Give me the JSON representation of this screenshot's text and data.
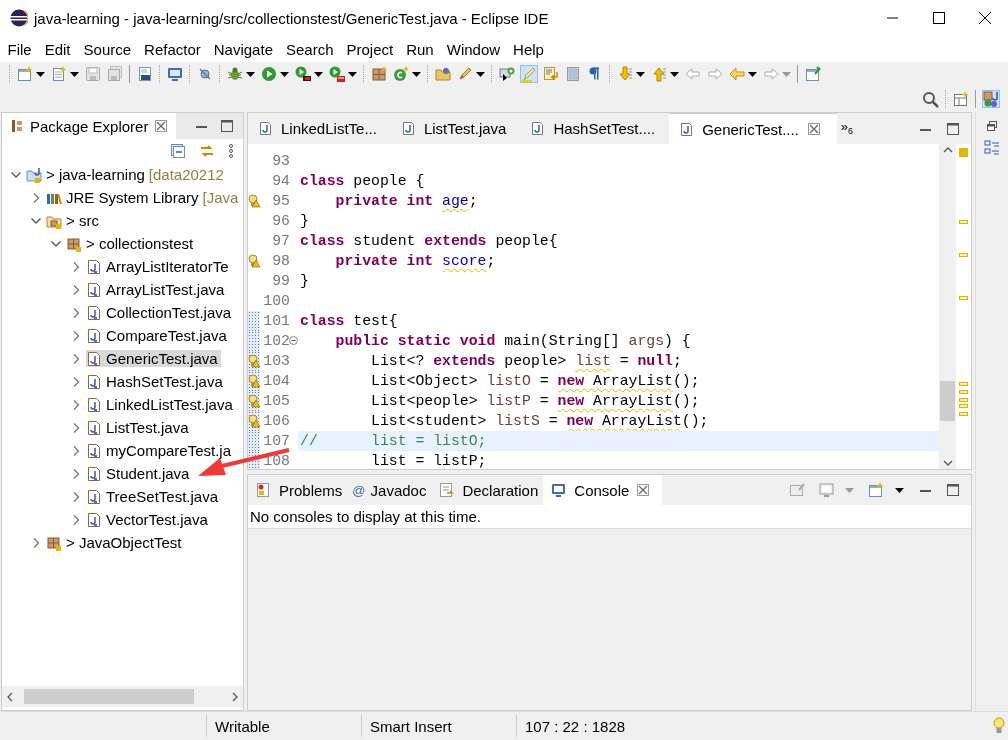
{
  "window": {
    "title": "java-learning - java-learning/src/collectionstest/GenericTest.java - Eclipse IDE"
  },
  "menu": [
    "File",
    "Edit",
    "Source",
    "Refactor",
    "Navigate",
    "Search",
    "Project",
    "Run",
    "Window",
    "Help"
  ],
  "package_explorer": {
    "title": "Package Explorer",
    "tree": [
      {
        "label": "> java-learning",
        "decoration": "[data20212",
        "kind": "project",
        "expanded": true,
        "selected": false,
        "children": [
          {
            "label": "JRE System Library",
            "decoration": "[Java",
            "kind": "library",
            "expanded": false,
            "selected": false
          },
          {
            "label": "> src",
            "kind": "source",
            "expanded": true,
            "selected": false,
            "children": [
              {
                "label": "> collectionstest",
                "kind": "package",
                "expanded": true,
                "selected": false,
                "children": [
                  {
                    "label": "ArrayListIteratorTe",
                    "kind": "file",
                    "expanded": false,
                    "selected": false
                  },
                  {
                    "label": "ArrayListTest.java",
                    "kind": "file",
                    "expanded": false,
                    "selected": false
                  },
                  {
                    "label": "CollectionTest.java",
                    "kind": "file",
                    "expanded": false,
                    "selected": false
                  },
                  {
                    "label": "CompareTest.java",
                    "kind": "file",
                    "expanded": false,
                    "selected": false
                  },
                  {
                    "label": "GenericTest.java",
                    "kind": "file",
                    "expanded": false,
                    "selected": true
                  },
                  {
                    "label": "HashSetTest.java",
                    "kind": "file",
                    "expanded": false,
                    "selected": false
                  },
                  {
                    "label": "LinkedListTest.java",
                    "kind": "file",
                    "expanded": false,
                    "selected": false
                  },
                  {
                    "label": "ListTest.java",
                    "kind": "file",
                    "expanded": false,
                    "selected": false
                  },
                  {
                    "label": "myCompareTest.ja",
                    "kind": "file",
                    "expanded": false,
                    "selected": false
                  },
                  {
                    "label": "Student.java",
                    "kind": "file",
                    "expanded": false,
                    "selected": false
                  },
                  {
                    "label": "TreeSetTest.java",
                    "kind": "file",
                    "expanded": false,
                    "selected": false
                  },
                  {
                    "label": "VectorTest.java",
                    "kind": "file",
                    "expanded": false,
                    "selected": false
                  }
                ]
              }
            ]
          },
          {
            "label": "> JavaObjectTest",
            "kind": "package",
            "expanded": false,
            "selected": false
          }
        ]
      }
    ]
  },
  "editor": {
    "tabs": [
      {
        "label": "LinkedListTe...",
        "selected": false
      },
      {
        "label": "ListTest.java",
        "selected": false
      },
      {
        "label": "HashSetTest....",
        "selected": false
      },
      {
        "label": "GenericTest....",
        "selected": true
      }
    ],
    "overflow": {
      "symbol": "»",
      "count": "6"
    },
    "lines": [
      {
        "number": "93"
      },
      {
        "number": "94",
        "tokens": [
          {
            "text": "class",
            "kind": "keyword"
          },
          {
            "text": " people {",
            "kind": "plain"
          }
        ]
      },
      {
        "number": "95",
        "warning": true,
        "tokens": [
          {
            "text": "    private int ",
            "kind": "keyword"
          },
          {
            "text": "age",
            "kind": "field",
            "warn": true
          },
          {
            "text": ";",
            "kind": "plain"
          }
        ]
      },
      {
        "number": "96",
        "tokens": [
          {
            "text": "}",
            "kind": "plain"
          }
        ]
      },
      {
        "number": "97",
        "tokens": [
          {
            "text": "class",
            "kind": "keyword"
          },
          {
            "text": " student ",
            "kind": "plain"
          },
          {
            "text": "extends",
            "kind": "keyword"
          },
          {
            "text": " people{",
            "kind": "plain"
          }
        ]
      },
      {
        "number": "98",
        "warning": true,
        "tokens": [
          {
            "text": "    private int ",
            "kind": "keyword"
          },
          {
            "text": "score",
            "kind": "field",
            "warn": true
          },
          {
            "text": ";",
            "kind": "plain"
          }
        ]
      },
      {
        "number": "99",
        "tokens": [
          {
            "text": "}",
            "kind": "plain"
          }
        ]
      },
      {
        "number": "100"
      },
      {
        "number": "101",
        "changed": true,
        "tokens": [
          {
            "text": "class",
            "kind": "keyword"
          },
          {
            "text": " test{",
            "kind": "plain"
          }
        ]
      },
      {
        "number": "102",
        "changed": true,
        "foldable": true,
        "tokens": [
          {
            "text": "    public static void",
            "kind": "keyword"
          },
          {
            "text": " main(String[] ",
            "kind": "plain"
          },
          {
            "text": "args",
            "kind": "local"
          },
          {
            "text": ") {",
            "kind": "plain"
          }
        ]
      },
      {
        "number": "103",
        "changed": true,
        "warning": true,
        "tokens": [
          {
            "text": "        List<? ",
            "kind": "plain"
          },
          {
            "text": "extends",
            "kind": "keyword"
          },
          {
            "text": " people> ",
            "kind": "plain"
          },
          {
            "text": "list",
            "kind": "local",
            "warn": true
          },
          {
            "text": " = ",
            "kind": "plain"
          },
          {
            "text": "null",
            "kind": "keyword"
          },
          {
            "text": ";",
            "kind": "plain"
          }
        ]
      },
      {
        "number": "104",
        "changed": true,
        "warning": true,
        "tokens": [
          {
            "text": "        List<Object> ",
            "kind": "plain"
          },
          {
            "text": "listO",
            "kind": "local"
          },
          {
            "text": " = ",
            "kind": "plain"
          },
          {
            "text": "new ",
            "kind": "keyword",
            "warn": true
          },
          {
            "text": "ArrayList",
            "kind": "plain",
            "warn": true
          },
          {
            "text": "();",
            "kind": "plain"
          }
        ]
      },
      {
        "number": "105",
        "changed": true,
        "warning": true,
        "tokens": [
          {
            "text": "        List<people> ",
            "kind": "plain"
          },
          {
            "text": "listP",
            "kind": "local"
          },
          {
            "text": " = ",
            "kind": "plain"
          },
          {
            "text": "new ",
            "kind": "keyword",
            "warn": true
          },
          {
            "text": "ArrayList",
            "kind": "plain",
            "warn": true
          },
          {
            "text": "();",
            "kind": "plain"
          }
        ]
      },
      {
        "number": "106",
        "changed": true,
        "warning": true,
        "tokens": [
          {
            "text": "        List<student> ",
            "kind": "plain"
          },
          {
            "text": "listS",
            "kind": "local"
          },
          {
            "text": " = ",
            "kind": "plain"
          },
          {
            "text": "new ",
            "kind": "keyword",
            "warn": true
          },
          {
            "text": "ArrayList",
            "kind": "plain",
            "warn": true
          },
          {
            "text": "();",
            "kind": "plain"
          }
        ]
      },
      {
        "number": "107",
        "changed": true,
        "current": true,
        "tokens": [
          {
            "text": "//      list = listO;",
            "kind": "comment"
          }
        ]
      },
      {
        "number": "108",
        "changed": true,
        "tokens": [
          {
            "text": "        list = listP;",
            "kind": "plain"
          }
        ]
      }
    ]
  },
  "bottom_panel": {
    "tabs": [
      {
        "label": "Problems",
        "kind": "problems",
        "selected": false
      },
      {
        "label": "Javadoc",
        "kind": "javadoc",
        "glyph": "@",
        "selected": false
      },
      {
        "label": "Declaration",
        "kind": "declaration",
        "selected": false
      },
      {
        "label": "Console",
        "kind": "console",
        "selected": true
      }
    ],
    "message": "No consoles to display at this time."
  },
  "status_bar": {
    "write_mode": "Writable",
    "insert_mode": "Smart Insert",
    "position": "107 : 22 : 1828"
  }
}
